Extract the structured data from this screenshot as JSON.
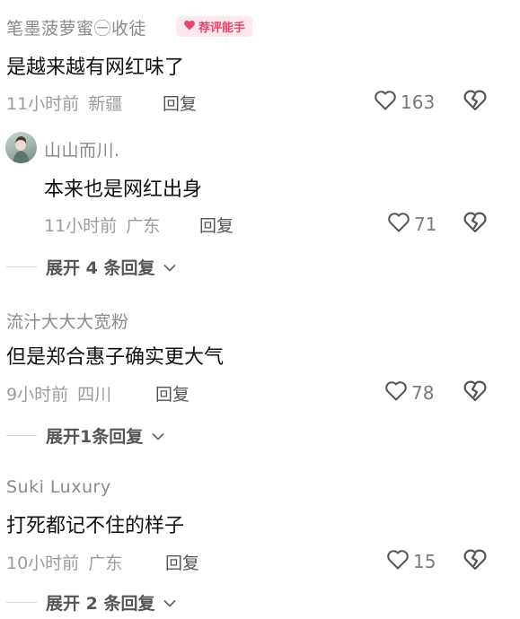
{
  "comments": [
    {
      "username": "笔墨菠萝蜜㊀收徒",
      "badge": "荐评能手",
      "text": "是越来越有网红味了",
      "time": "11小时前",
      "location": "新疆",
      "reply_label": "回复",
      "likes": "163"
    },
    {
      "username": "山山而川.",
      "text": "本来也是网红出身",
      "time": "11小时前",
      "location": "广东",
      "reply_label": "回复",
      "likes": "71",
      "expand_label": "展开 4 条回复"
    },
    {
      "username": "流汁大大大宽粉",
      "text": "但是郑合惠子确实更大气",
      "time": "9小时前",
      "location": "四川",
      "reply_label": "回复",
      "likes": "78",
      "expand_label": "展开1条回复"
    },
    {
      "username": "Suki Luxury",
      "text": "打死都记不住的样子",
      "time": "10小时前",
      "location": "广东",
      "reply_label": "回复",
      "likes": "15",
      "expand_label": "展开 2 条回复"
    }
  ],
  "icons": {
    "like": "heart-outline-icon",
    "dislike": "broken-heart-icon",
    "expand": "chevron-down-icon",
    "badge": "heart-icon"
  },
  "colors": {
    "badge_text": "#e8456b",
    "badge_bg": "#fde8ee",
    "meta": "#9b9b9b"
  }
}
